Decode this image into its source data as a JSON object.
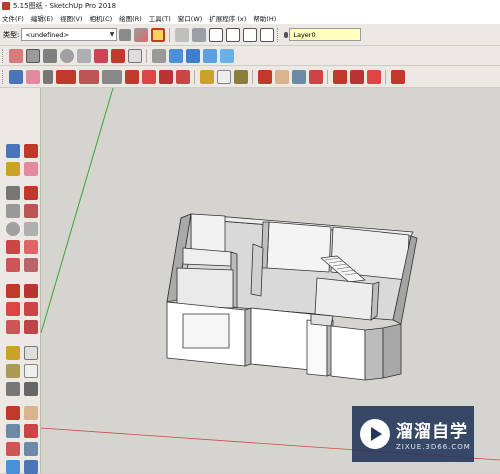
{
  "window": {
    "title": "5.15图纸 - SketchUp Pro 2018"
  },
  "menu": [
    "文件(F)",
    "编辑(E)",
    "视图(V)",
    "相机(C)",
    "绘图(R)",
    "工具(T)",
    "窗口(W)",
    "扩展程序 (x)",
    "帮助(H)"
  ],
  "toolbar": {
    "type_label": "类型:",
    "type_value": "<undefined>",
    "layer_value": "Layer0"
  },
  "watermark": {
    "title": "溜溜自学",
    "subtitle": "ZIXUE.3D66.COM"
  },
  "colors": {
    "accent_red": "#c0392b",
    "axis_green": "#3aa53a",
    "axis_red": "#c74a4a",
    "layer_bg": "#ffffc0"
  }
}
